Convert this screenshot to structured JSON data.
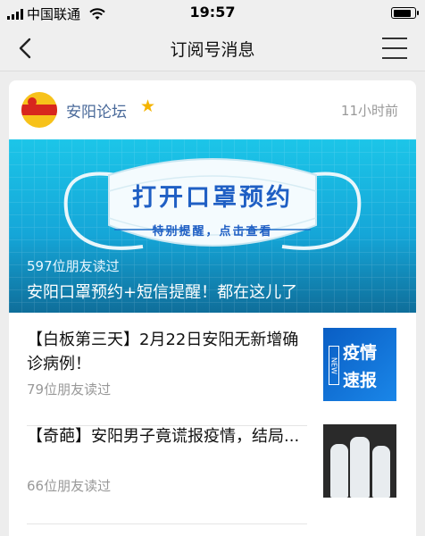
{
  "status_bar": {
    "carrier": "中国联通",
    "time": "19:57",
    "battery_level": 0.9
  },
  "nav": {
    "title": "订阅号消息",
    "back_icon": "chevron-left-icon",
    "menu_icon": "hamburger-menu-icon"
  },
  "account": {
    "name": "安阳论坛",
    "time": "11小时前",
    "star_icon": "star-icon"
  },
  "banner": {
    "headline": "打开口罩预约",
    "subline": "特别提醒，点击查看",
    "reads": "597位朋友读过",
    "caption": "安阳口罩预约+短信提醒！都在这儿了"
  },
  "articles": [
    {
      "title": "【白板第三天】2月22日安阳无新增确诊病例！",
      "reads": "79位朋友读过",
      "thumb_line1": "疫情",
      "thumb_line2": "速报",
      "thumb_tag": "NEW"
    },
    {
      "title": "【奇葩】安阳男子竟谎报疫情，结局...",
      "reads": "66位朋友读过"
    }
  ],
  "colors": {
    "account_name": "#4a6a9a",
    "star": "#f5b400",
    "banner_top": "#1cc5e8",
    "thumb_blue": "#0a5ec4"
  }
}
